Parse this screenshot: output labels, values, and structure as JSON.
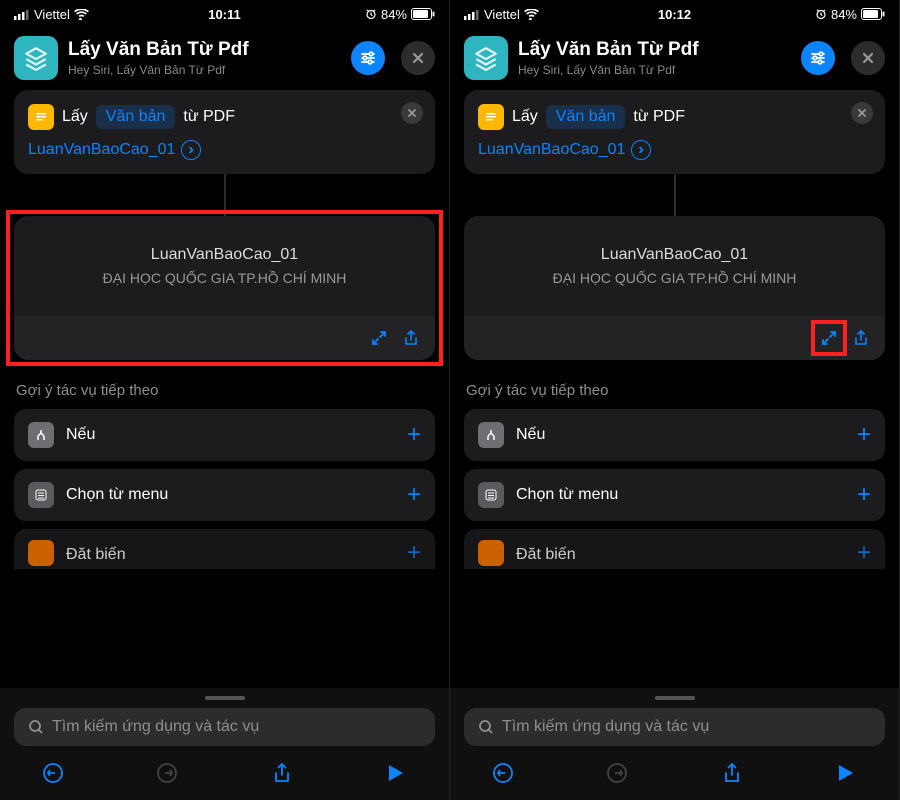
{
  "screens": [
    {
      "status": {
        "carrier": "Viettel",
        "time": "10:11",
        "battery": "84%"
      },
      "header": {
        "title": "Lấy Văn Bản Từ Pdf",
        "subtitle": "Hey Siri, Lấy Văn Bản Từ Pdf"
      },
      "action": {
        "verb": "Lấy",
        "param": "Văn bản",
        "from": "từ PDF",
        "file": "LuanVanBaoCao_01"
      },
      "result": {
        "title": "LuanVanBaoCao_01",
        "text": "ĐẠI HỌC QUỐC GIA TP.HỒ CHÍ MINH"
      },
      "suggest_label": "Gợi ý tác vụ tiếp theo",
      "suggestions": [
        {
          "label": "Nếu",
          "icon_bg": "#6e6e73"
        },
        {
          "label": "Chọn từ menu",
          "icon_bg": "#5a5a5f"
        },
        {
          "label": "Đặt biến",
          "icon_bg": "#ff7a00"
        }
      ],
      "search_placeholder": "Tìm kiếm ứng dụng và tác vụ",
      "highlight": {
        "type": "card"
      }
    },
    {
      "status": {
        "carrier": "Viettel",
        "time": "10:12",
        "battery": "84%"
      },
      "header": {
        "title": "Lấy Văn Bản Từ Pdf",
        "subtitle": "Hey Siri, Lấy Văn Bản Từ Pdf"
      },
      "action": {
        "verb": "Lấy",
        "param": "Văn bản",
        "from": "từ PDF",
        "file": "LuanVanBaoCao_01"
      },
      "result": {
        "title": "LuanVanBaoCao_01",
        "text": "ĐẠI HỌC QUỐC GIA TP.HỒ CHÍ MINH"
      },
      "suggest_label": "Gợi ý tác vụ tiếp theo",
      "suggestions": [
        {
          "label": "Nếu",
          "icon_bg": "#6e6e73"
        },
        {
          "label": "Chọn từ menu",
          "icon_bg": "#5a5a5f"
        },
        {
          "label": "Đặt biến",
          "icon_bg": "#ff7a00"
        }
      ],
      "search_placeholder": "Tìm kiếm ứng dụng và tác vụ",
      "highlight": {
        "type": "expand"
      }
    }
  ]
}
